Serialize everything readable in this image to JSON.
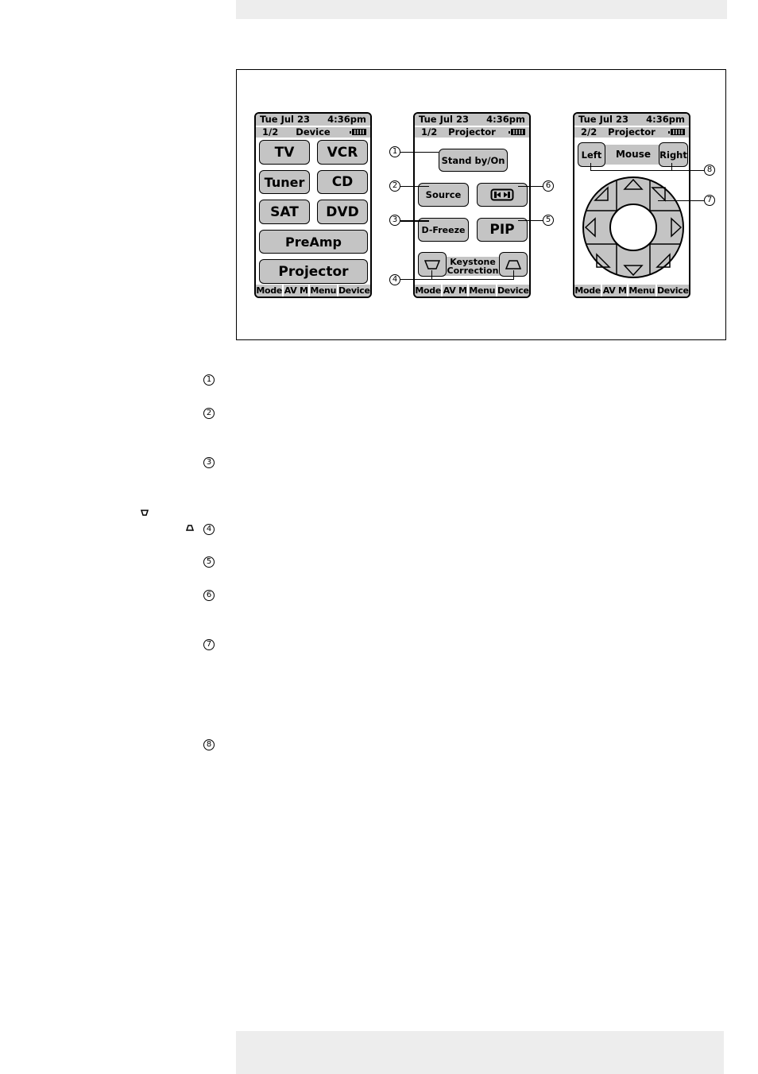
{
  "page": {
    "margin_callouts": [
      "1",
      "2",
      "3",
      "4",
      "5",
      "6",
      "7",
      "8"
    ],
    "margin_icons": [
      "keystone-down-icon",
      "keystone-up-icon"
    ]
  },
  "screens": [
    {
      "date": "Tue Jul 23",
      "time": "4:36pm",
      "page": "1/2",
      "title": "Device",
      "buttons": [
        "TV",
        "VCR",
        "Tuner",
        "CD",
        "SAT",
        "DVD",
        "PreAmp",
        "Projector"
      ],
      "tabs": [
        "Mode",
        "AV M",
        "Menu",
        "Device"
      ]
    },
    {
      "date": "Tue Jul 23",
      "time": "4:36pm",
      "page": "1/2",
      "title": "Projector",
      "buttons": {
        "standby": "Stand by/On",
        "source": "Source",
        "aspect": "aspect-ratio-icon",
        "dfreeze": "D-Freeze",
        "pip": "PIP",
        "keystone_label_1": "Keystone",
        "keystone_label_2": "Correction"
      },
      "tabs": [
        "Mode",
        "AV M",
        "Menu",
        "Device"
      ],
      "callouts": [
        "1",
        "2",
        "3",
        "4",
        "5",
        "6"
      ]
    },
    {
      "date": "Tue Jul 23",
      "time": "4:36pm",
      "page": "2/2",
      "title": "Projector",
      "buttons": {
        "left": "Left",
        "mouse": "Mouse",
        "right": "Right"
      },
      "tabs": [
        "Mode",
        "AV M",
        "Menu",
        "Device"
      ],
      "callouts": [
        "7",
        "8"
      ]
    }
  ]
}
